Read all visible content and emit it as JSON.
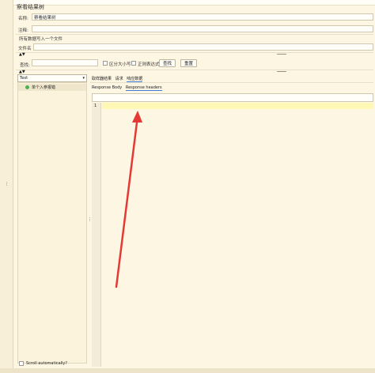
{
  "panel": {
    "title": "察看结果树",
    "name_label": "名称:",
    "name_value": "察看结果树",
    "comment_label": "注释:",
    "comment_value": "",
    "write_all_label": "所有数据写入一个文件",
    "filename_label": "文件名",
    "filename_value": ""
  },
  "search": {
    "label": "查找:",
    "case_label": "区分大小写",
    "regex_label": "正则表达式",
    "find_button": "查找",
    "reset_button": "重置"
  },
  "renderer": {
    "selected": "Text"
  },
  "tree": {
    "items": [
      {
        "label": "单个入参报错",
        "status": "success"
      }
    ]
  },
  "tabs": {
    "sampler": "取样器结果",
    "request": "请求",
    "response": "响应数据"
  },
  "subtabs": {
    "body": "Response Body",
    "headers": "Response headers"
  },
  "editor": {
    "line_number": "1"
  },
  "footer": {
    "scroll_label": "Scroll automatically?"
  },
  "colors": {
    "accent": "#e53935",
    "highlight": "#fff8b5",
    "success": "#4caf50"
  }
}
